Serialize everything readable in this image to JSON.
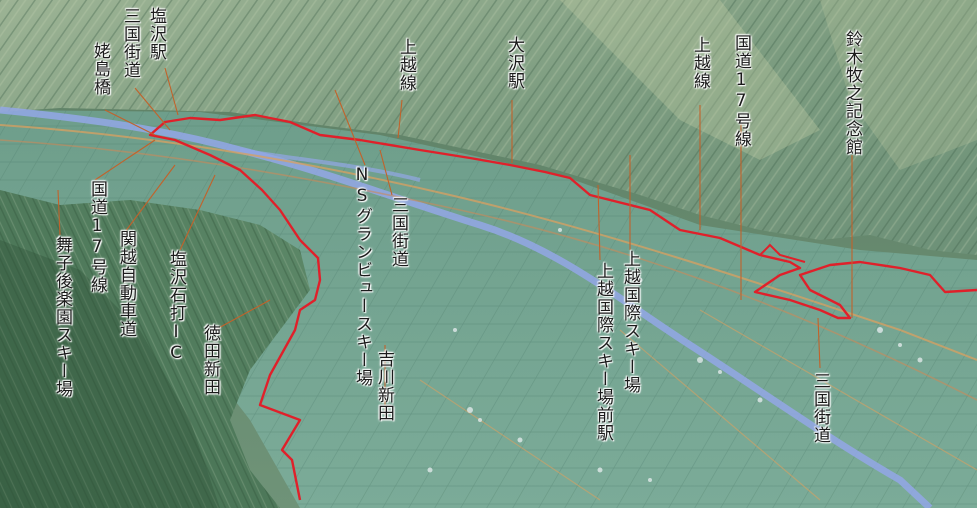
{
  "labels": {
    "shiozawa_station": "塩沢駅",
    "mikuni_kaido_nw": "三国街道",
    "ubashima_bridge": "姥島橋",
    "route17_west": "国道17号線",
    "kanetsu_expressway": "関越自動車道",
    "maiko_ski": "舞子後楽園スキー場",
    "shiozawa_ishiuchi_ic": "塩沢石打IC",
    "tokuda_shinden": "徳田新田",
    "ns_granview_ski": "NSグランビュースキー場",
    "mikuni_kaido_mid": "三国街道",
    "yoshikawa_shinden": "吉川新田",
    "joetsu_line_west": "上越線",
    "osawa_station": "大沢駅",
    "joetsu_kokusai_ski_station": "上越国際スキー場前駅",
    "joetsu_kokusai_ski": "上越国際スキー場",
    "joetsu_line_east": "上越線",
    "route17_east": "国道17号線",
    "suzuki_bokushi_museum": "鈴木牧之記念館",
    "mikuni_kaido_se": "三国街道"
  },
  "colors": {
    "route": "#e0202a",
    "leader": "#c2622a",
    "river": "#93a7e6",
    "valley": "#74a491",
    "mountain": "#567f5e"
  }
}
